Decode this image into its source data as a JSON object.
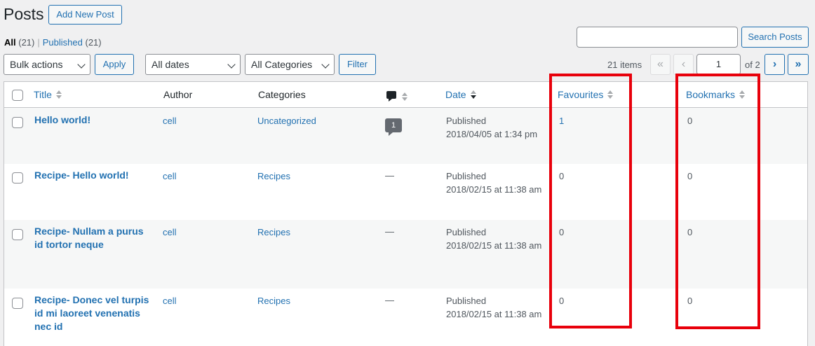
{
  "header": {
    "title": "Posts",
    "add_new_label": "Add New Post"
  },
  "views": {
    "all_label": "All",
    "all_count": "(21)",
    "separator": "|",
    "published_label": "Published",
    "published_count": "(21)"
  },
  "search": {
    "value": "",
    "button_label": "Search Posts"
  },
  "toolbar": {
    "bulk_actions": "Bulk actions",
    "apply_label": "Apply",
    "dates_filter": "All dates",
    "categories_filter": "All Categories",
    "filter_label": "Filter"
  },
  "pagination": {
    "items_text": "21 items",
    "first": "«",
    "prev": "‹",
    "current_page": "1",
    "of_text": "of 2",
    "next": "›",
    "last": "»"
  },
  "columns": {
    "title": "Title",
    "author": "Author",
    "categories": "Categories",
    "date": "Date",
    "favourites": "Favourites",
    "bookmarks": "Bookmarks"
  },
  "rows": [
    {
      "title_line1": "Hello world!",
      "title_line2": "",
      "title_line3": "",
      "author": "cell",
      "category": "Uncategorized",
      "comments": "1",
      "status": "Published",
      "date": "2018/04/05 at 1:34 pm",
      "favourites": "1",
      "bookmarks": "0"
    },
    {
      "title_line1": "Recipe- Hello world!",
      "title_line2": "",
      "title_line3": "",
      "author": "cell",
      "category": "Recipes",
      "comments": "—",
      "status": "Published",
      "date": "2018/02/15 at 11:38 am",
      "favourites": "0",
      "bookmarks": "0"
    },
    {
      "title_line1": "Recipe- Nullam a purus",
      "title_line2": "id tortor neque",
      "title_line3": "",
      "author": "cell",
      "category": "Recipes",
      "comments": "—",
      "status": "Published",
      "date": "2018/02/15 at 11:38 am",
      "favourites": "0",
      "bookmarks": "0"
    },
    {
      "title_line1": "Recipe- Donec vel turpis",
      "title_line2": "id mi laoreet venenatis",
      "title_line3": "nec id",
      "author": "cell",
      "category": "Recipes",
      "comments": "—",
      "status": "Published",
      "date": "2018/02/15 at 11:38 am",
      "favourites": "0",
      "bookmarks": "0"
    }
  ],
  "colors": {
    "accent": "#2271b1",
    "highlight": "#e8000b",
    "background": "#f0f0f1"
  }
}
